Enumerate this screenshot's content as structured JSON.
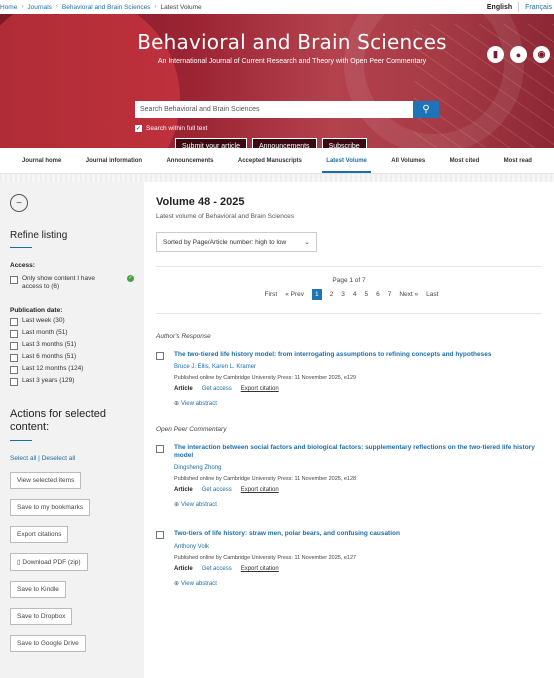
{
  "breadcrumb": {
    "home": "Home",
    "journals": "Journals",
    "journal": "Behavioral and Brain Sciences",
    "current": "Latest Volume"
  },
  "lang": {
    "english": "English",
    "french": "Français"
  },
  "hero": {
    "title": "Behavioral and Brain Sciences",
    "subtitle": "An International Journal of Current Research and Theory with Open Peer Commentary",
    "search_placeholder": "Search Behavioral and Brain Sciences",
    "search_full_text": "Search within full text",
    "submit": "Submit your article",
    "announcements": "Announcements",
    "subscribe": "Subscribe"
  },
  "nav": [
    "Journal home",
    "Journal information",
    "Announcements",
    "Accepted Manuscripts",
    "Latest Volume",
    "All Volumes",
    "Most cited",
    "Most read"
  ],
  "sidebar": {
    "refine": "Refine listing",
    "access_heading": "Access:",
    "access_option": "Only show content I have access to (6)",
    "pubdate_heading": "Publication date:",
    "pubdates": [
      "Last week (30)",
      "Last month (51)",
      "Last 3 months (51)",
      "Last 6 months (51)",
      "Last 12 months (124)",
      "Last 3 years (129)"
    ],
    "actions_heading": "Actions for selected content:",
    "select_all": "Select all",
    "deselect_all": "Deselect all",
    "buttons": [
      "View selected items",
      "Save to my bookmarks",
      "Export citations",
      "Download PDF (zip)",
      "Save to Kindle",
      "Save to Dropbox",
      "Save to Google Drive"
    ]
  },
  "main": {
    "volume": "Volume 48 - 2025",
    "latest": "Latest volume of Behavioral and Brain Sciences",
    "sort": "Sorted by Page/Article number: high to low",
    "page_of": "Page 1 of 7",
    "pager": [
      "First",
      "« Prev",
      "1",
      "2",
      "3",
      "4",
      "5",
      "6",
      "7",
      "Next »",
      "Last"
    ],
    "sections": [
      {
        "category": "Author's Response",
        "title": "The two-tiered life history model: from interrogating assumptions to refining concepts and hypotheses",
        "authors": "Bruce J. Ellis, Karen L. Kramer",
        "published": "Published online by Cambridge University Press: 11 November 2025, e129",
        "type": "Article",
        "access": "Get access",
        "export": "Export citation",
        "abstract": "View abstract"
      },
      {
        "category": "Open Peer Commentary",
        "title": "The interaction between social factors and biological factors: supplementary reflections on the two-tiered life history model",
        "authors": "Dingsheng Zhong",
        "published": "Published online by Cambridge University Press: 11 November 2025, e128",
        "type": "Article",
        "access": "Get access",
        "export": "Export citation",
        "abstract": "View abstract"
      },
      {
        "category": "",
        "title": "Two-tiers of life history: straw men, polar bears, and confusing causation",
        "authors": "Anthony Volk",
        "published": "Published online by Cambridge University Press: 11 November 2025, e127",
        "type": "Article",
        "access": "Get access",
        "export": "Export citation",
        "abstract": "View abstract"
      }
    ]
  }
}
